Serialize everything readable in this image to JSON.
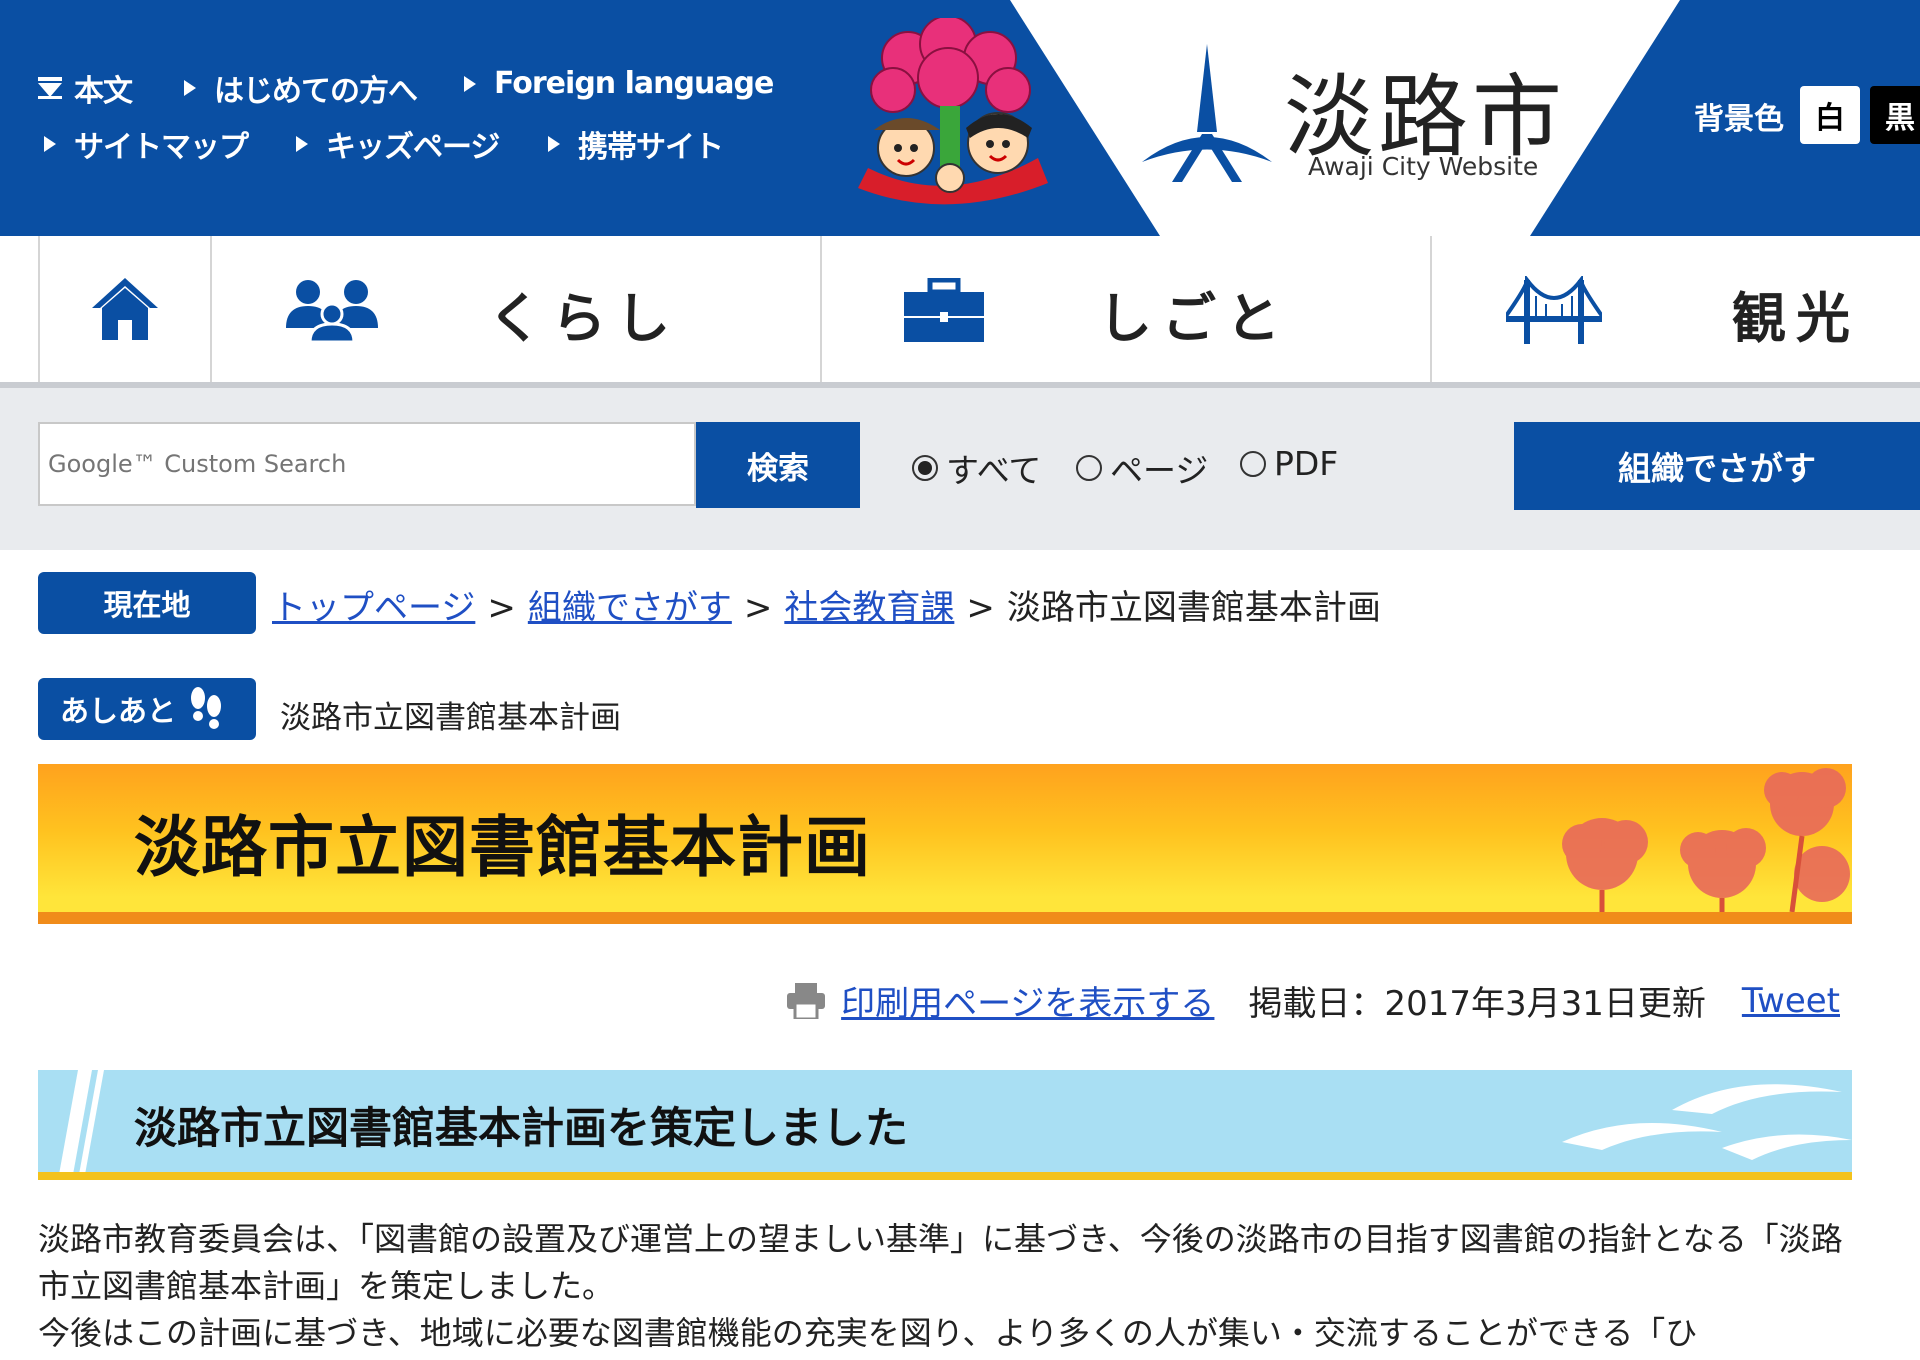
{
  "utility_nav": {
    "skip": "本文",
    "first_time": "はじめての方へ",
    "foreign": "Foreign language",
    "sitemap": "サイトマップ",
    "kids": "キッズページ",
    "mobile": "携帯サイト"
  },
  "site": {
    "name": "淡路市",
    "subtitle": "Awaji City Website"
  },
  "bg_color": {
    "label": "背景色",
    "white": "白",
    "black": "黒"
  },
  "global_nav": [
    {
      "label": "くらし"
    },
    {
      "label": "しごと"
    },
    {
      "label": "観光"
    }
  ],
  "search": {
    "placeholder": "Google™ Custom Search",
    "button": "検索",
    "options": [
      "すべて",
      "ページ",
      "PDF"
    ],
    "selected": "すべて",
    "org_button": "組織でさがす"
  },
  "breadcrumb": {
    "tag": "現在地",
    "items": [
      "トップページ",
      "組織でさがす",
      "社会教育課"
    ],
    "current": "淡路市立図書館基本計画",
    "separator": ">"
  },
  "ashiato": {
    "tag": "あしあと",
    "item": "淡路市立図書館基本計画"
  },
  "page": {
    "title": "淡路市立図書館基本計画",
    "print_link": "印刷用ページを表示する",
    "date": "掲載日：2017年3月31日更新",
    "tweet": "Tweet"
  },
  "section": {
    "heading": "淡路市立図書館基本計画を策定しました"
  },
  "body": {
    "p1": "淡路市教育委員会は、「図書館の設置及び運営上の望ましい基準」に基づき、今後の淡路市の目指す図書館の指針となる「淡路市立図書館基本計画」を策定しました。",
    "p2": "今後はこの計画に基づき、地域に必要な図書館機能の充実を図り、より多くの人が集い・交流することができる「ひ"
  },
  "colors": {
    "brand_blue": "#0a4fa3",
    "banner_orange": "#ffa21e",
    "section_blue": "#a9dff3",
    "link": "#1f4fc4"
  },
  "icons": [
    "skip-icon",
    "home-icon",
    "people-icon",
    "briefcase-icon",
    "bridge-icon",
    "footprints-icon",
    "printer-icon",
    "mascot-logo",
    "city-logo-mark"
  ]
}
